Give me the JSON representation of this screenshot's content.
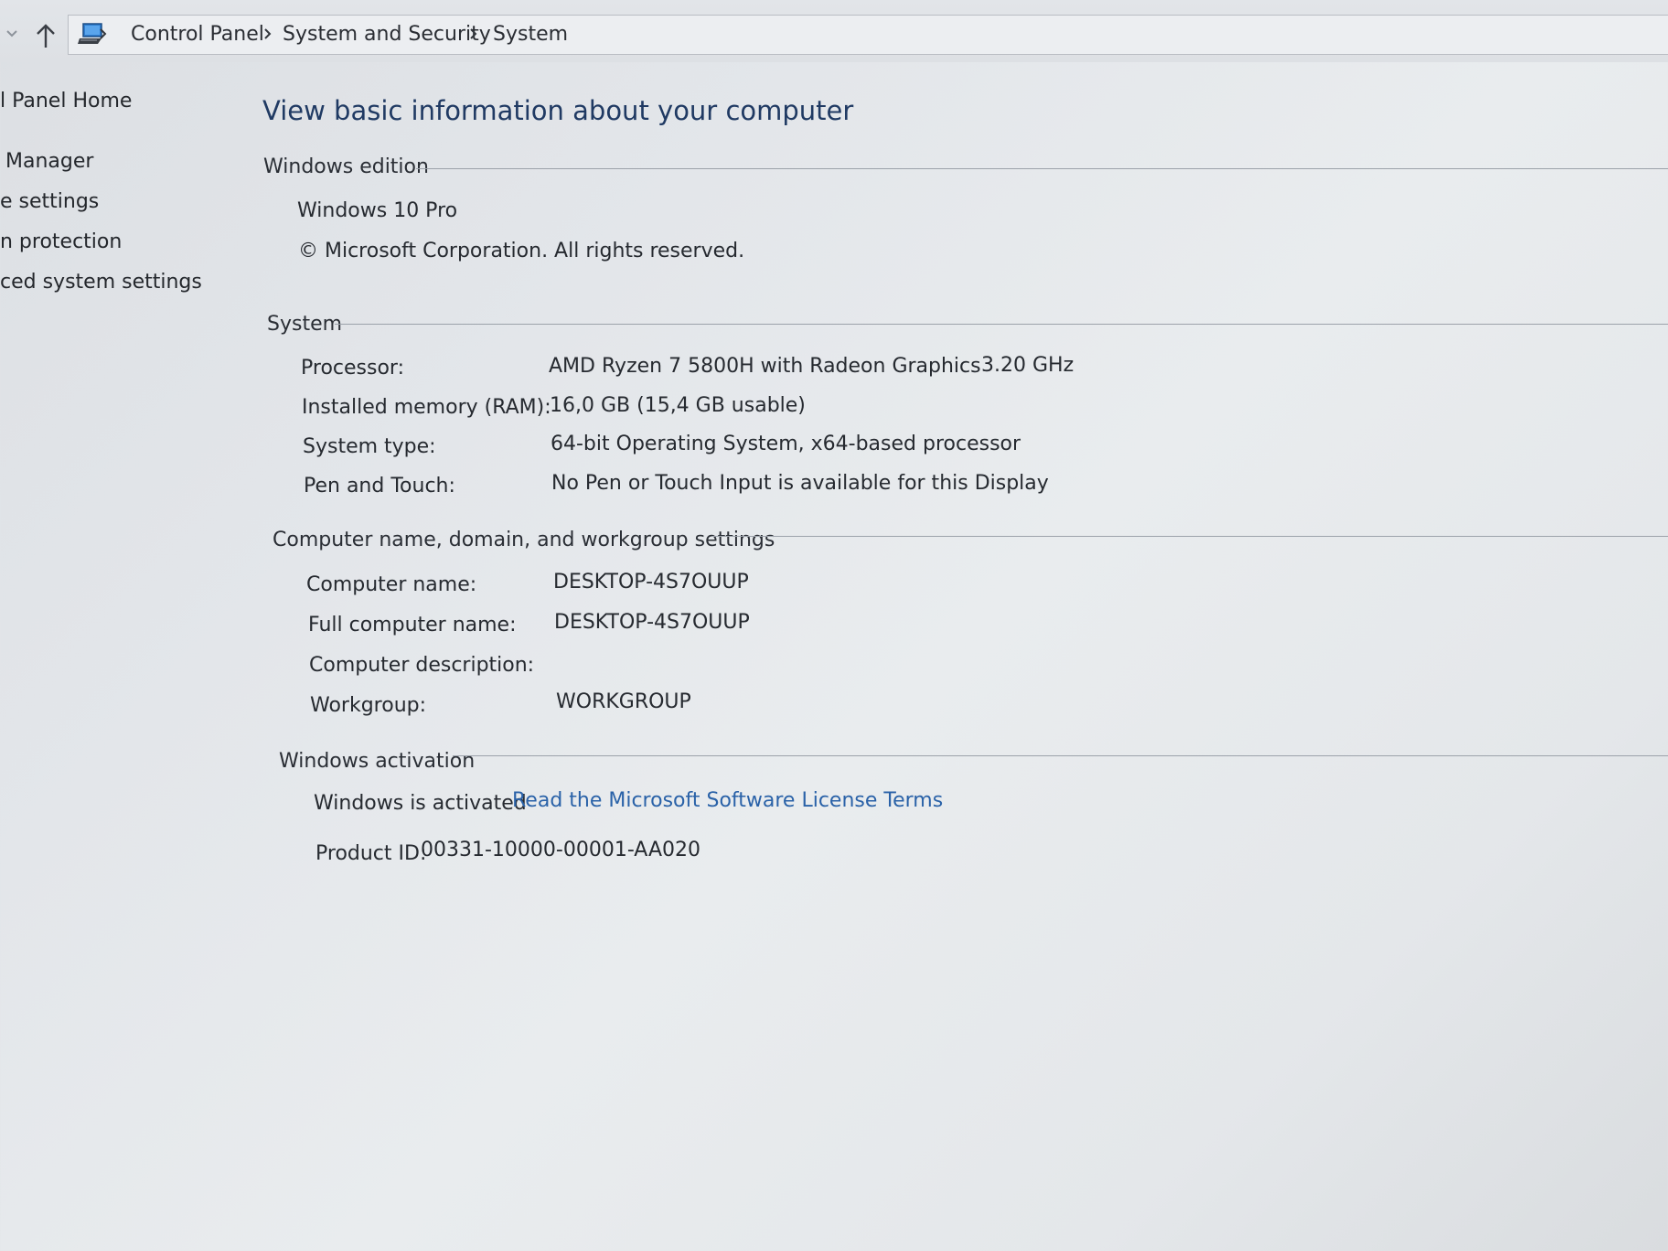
{
  "breadcrumb": {
    "items": [
      "Control Panel",
      "System and Security",
      "System"
    ]
  },
  "sidebar": {
    "items": [
      {
        "label": "l Panel Home"
      },
      {
        "label": "Manager"
      },
      {
        "label": "e settings"
      },
      {
        "label": "n protection"
      },
      {
        "label": "ced system settings"
      }
    ]
  },
  "main": {
    "title": "View basic information about your computer",
    "windows_edition": {
      "heading": "Windows edition",
      "edition": "Windows 10 Pro",
      "copyright": "© Microsoft Corporation. All rights reserved."
    },
    "system": {
      "heading": "System",
      "rows": [
        {
          "label": "Processor:",
          "value": "AMD Ryzen 7 5800H with Radeon Graphics",
          "extra": "3.20 GHz"
        },
        {
          "label": "Installed memory (RAM):",
          "value": "16,0 GB (15,4 GB usable)"
        },
        {
          "label": "System type:",
          "value": "64-bit Operating System, x64-based processor"
        },
        {
          "label": "Pen and Touch:",
          "value": "No Pen or Touch Input is available for this Display"
        }
      ]
    },
    "computer_name": {
      "heading": "Computer name, domain, and workgroup settings",
      "rows": [
        {
          "label": "Computer name:",
          "value": "DESKTOP-4S7OUUP"
        },
        {
          "label": "Full computer name:",
          "value": "DESKTOP-4S7OUUP"
        },
        {
          "label": "Computer description:",
          "value": ""
        },
        {
          "label": "Workgroup:",
          "value": "WORKGROUP"
        }
      ]
    },
    "activation": {
      "heading": "Windows activation",
      "status": "Windows is activated",
      "license_link": "Read the Microsoft Software License Terms",
      "product_id_label": "Product ID:",
      "product_id": "00331-10000-00001-AA020"
    }
  },
  "colors": {
    "title": "#203a63",
    "link": "#2a62a8",
    "background": "#e6e9ec"
  }
}
